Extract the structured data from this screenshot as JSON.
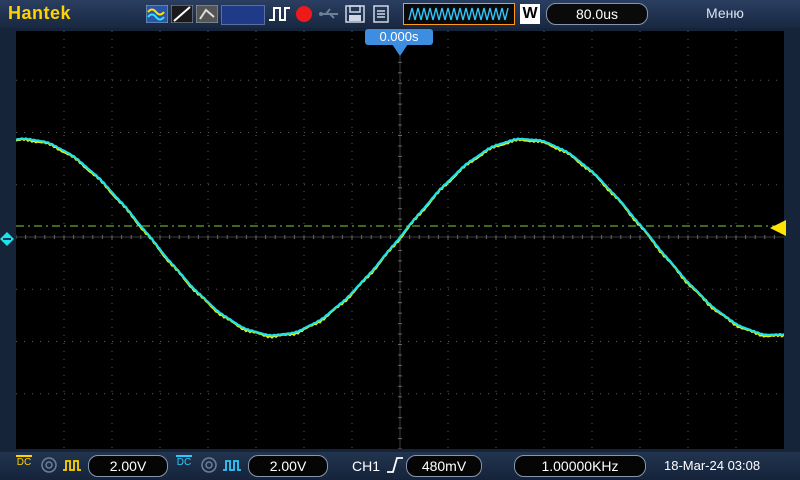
{
  "brand": "Hantek",
  "toolbar": {
    "run_state_icon": "record-dot-icon",
    "timebase_mark": "W",
    "timebase": "80.0us",
    "menu": "Меню"
  },
  "screen": {
    "trigger_position": "0.000s",
    "colors": {
      "ch1": "#f2f000",
      "ch2": "#20e0e8",
      "trigger_level": "#7ad232",
      "grid": "#666666"
    }
  },
  "bottom": {
    "ch1_volts_div": "2.00V",
    "ch2_volts_div": "2.00V",
    "trigger_source": "CH1",
    "trigger_level": "480mV",
    "frequency": "1.00000KHz",
    "datetime": "18-Mar-24 03:08",
    "coupling": "DC"
  }
}
